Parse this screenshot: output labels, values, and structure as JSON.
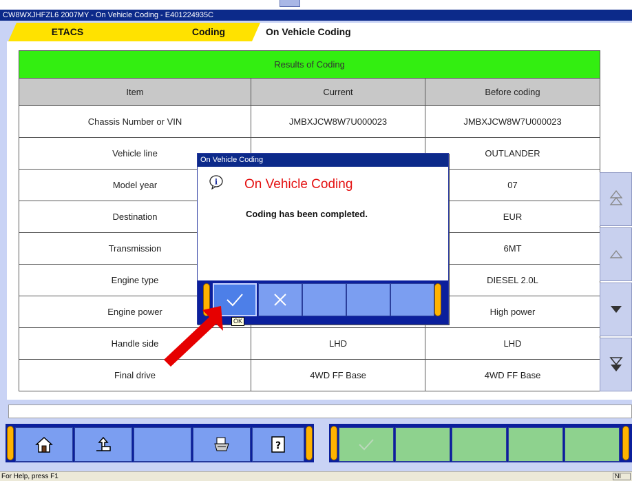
{
  "window": {
    "title": "CW8WXJHFZL6 2007MY   -  On Vehicle Coding  -  E401224935C"
  },
  "breadcrumb": {
    "tabs": [
      {
        "label": "ETACS"
      },
      {
        "label": "Coding"
      },
      {
        "label": "On Vehicle Coding"
      }
    ]
  },
  "results": {
    "caption": "Results of Coding",
    "columns": [
      "Item",
      "Current",
      "Before coding"
    ],
    "rows": [
      {
        "item": "Chassis Number or VIN",
        "current": "JMBXJCW8W7U000023",
        "before": "JMBXJCW8W7U000023"
      },
      {
        "item": "Vehicle line",
        "current": "",
        "before": "OUTLANDER"
      },
      {
        "item": "Model year",
        "current": "",
        "before": "07"
      },
      {
        "item": "Destination",
        "current": "",
        "before": "EUR"
      },
      {
        "item": "Transmission",
        "current": "",
        "before": "6MT"
      },
      {
        "item": "Engine type",
        "current": "",
        "before": "DIESEL 2.0L"
      },
      {
        "item": "Engine power",
        "current": "",
        "before": "High power"
      },
      {
        "item": "Handle side",
        "current": "LHD",
        "before": "LHD"
      },
      {
        "item": "Final drive",
        "current": "4WD FF Base",
        "before": "4WD FF Base"
      }
    ]
  },
  "dialog": {
    "title": "On Vehicle Coding",
    "heading": "On Vehicle Coding",
    "message": "Coding has been completed.",
    "ok_tooltip": "OK"
  },
  "statusbar": {
    "help_text": "For Help, press F1",
    "indicator": "NI"
  },
  "colors": {
    "accent_blue": "#0b1f9c",
    "tab_yellow": "#ffe200",
    "caption_green": "#33ee11",
    "heading_red": "#e41010",
    "annotation_arrow": "#e60000"
  }
}
